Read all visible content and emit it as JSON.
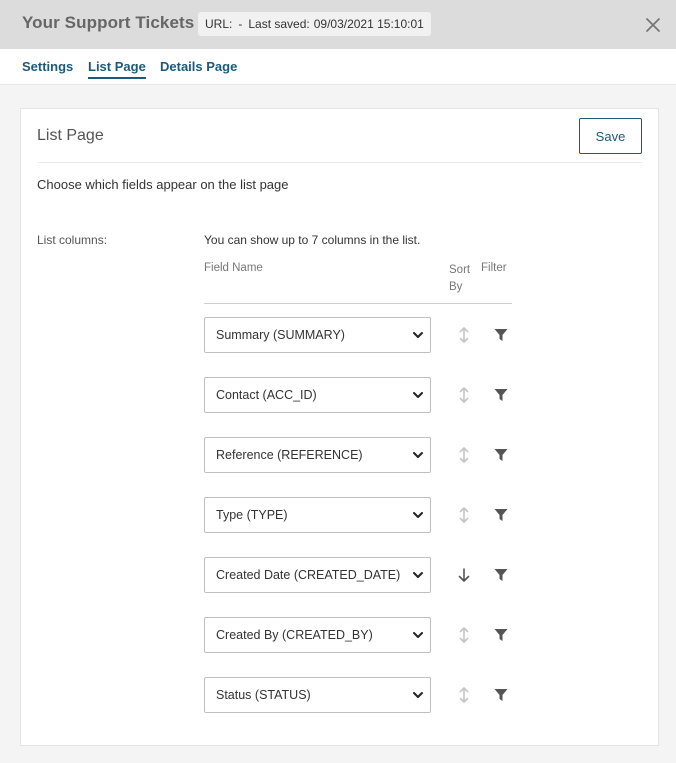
{
  "header": {
    "title": "Your Support Tickets",
    "url_label": "URL:",
    "url_value": "-",
    "saved_label": "Last saved:",
    "saved_value": "09/03/2021 15:10:01"
  },
  "tabs": [
    {
      "label": "Settings",
      "active": false
    },
    {
      "label": "List Page",
      "active": true
    },
    {
      "label": "Details Page",
      "active": false
    }
  ],
  "panel": {
    "title": "List Page",
    "save_label": "Save",
    "description": "Choose which fields appear on the list page",
    "list_columns_label": "List columns:",
    "hint": "You can show up to 7 columns in the list.",
    "col_field": "Field Name",
    "col_sort": "Sort By",
    "col_filter": "Filter"
  },
  "rows": [
    {
      "field": "Summary (SUMMARY)",
      "sort": "none"
    },
    {
      "field": "Contact (ACC_ID)",
      "sort": "none"
    },
    {
      "field": "Reference (REFERENCE)",
      "sort": "none"
    },
    {
      "field": "Type (TYPE)",
      "sort": "none"
    },
    {
      "field": "Created Date (CREATED_DATE)",
      "sort": "descending"
    },
    {
      "field": "Created By (CREATED_BY)",
      "sort": "none"
    },
    {
      "field": "Status (STATUS)",
      "sort": "none"
    }
  ],
  "colors": {
    "accent": "#1d5a7a",
    "titlebar": "#dcdcdc",
    "icon_active": "#555555",
    "icon_inactive": "#c4c4c4"
  },
  "icons": {
    "close": "close-icon",
    "chevron": "chevron-down-icon",
    "sort_none": "sort-both-icon",
    "sort_desc": "sort-descending-icon",
    "filter": "filter-icon"
  }
}
